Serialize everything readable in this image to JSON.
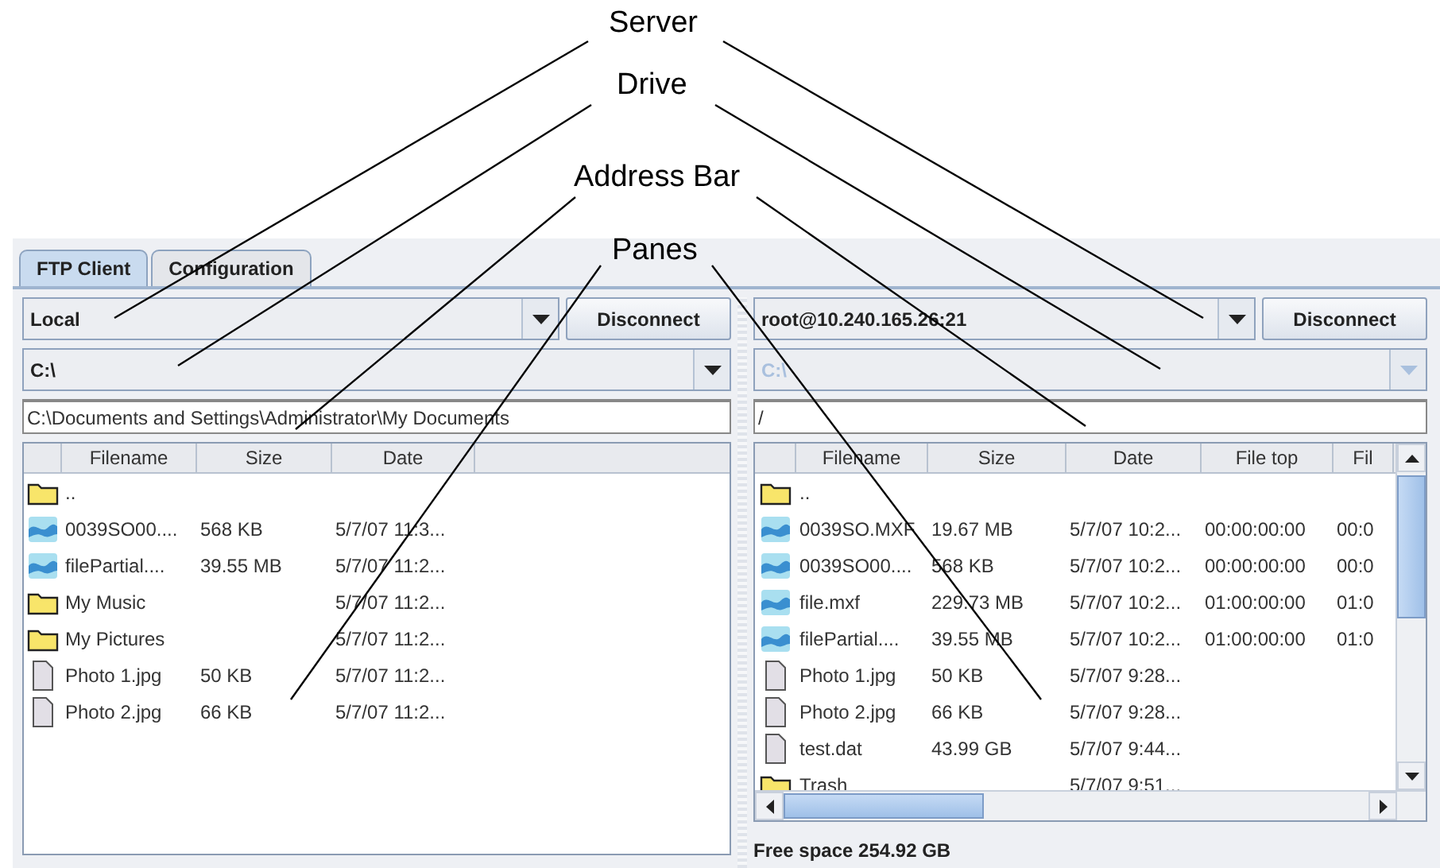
{
  "annotations": [
    {
      "label": "Server"
    },
    {
      "label": "Drive"
    },
    {
      "label": "Address Bar"
    },
    {
      "label": "Panes"
    }
  ],
  "tabs": [
    {
      "label": "FTP Client",
      "selected": true
    },
    {
      "label": "Configuration",
      "selected": false
    }
  ],
  "panes": [
    {
      "server": "Local",
      "connect_button": "Disconnect",
      "drive": {
        "value": "C:\\",
        "disabled": false
      },
      "address": "C:\\Documents and Settings\\Administrator\\My Documents",
      "scrollbars": false,
      "columns": [
        "Filename",
        "Size",
        "Date"
      ],
      "rows": [
        {
          "kind": "folder",
          "cells": [
            ".."
          ]
        },
        {
          "kind": "media",
          "cells": [
            "0039SO00....",
            "568 KB",
            "5/7/07 11:3..."
          ]
        },
        {
          "kind": "media",
          "cells": [
            "filePartial....",
            "39.55 MB",
            "5/7/07 11:2..."
          ]
        },
        {
          "kind": "folder",
          "cells": [
            "My Music",
            "",
            "5/7/07 11:2..."
          ]
        },
        {
          "kind": "folder",
          "cells": [
            "My Pictures",
            "",
            "5/7/07 11:2..."
          ]
        },
        {
          "kind": "file",
          "cells": [
            "Photo 1.jpg",
            "50 KB",
            "5/7/07 11:2..."
          ]
        },
        {
          "kind": "file",
          "cells": [
            "Photo 2.jpg",
            "66 KB",
            "5/7/07 11:2..."
          ]
        }
      ]
    },
    {
      "server": "root@10.240.165.26:21",
      "connect_button": "Disconnect",
      "drive": {
        "value": "C:\\",
        "disabled": true
      },
      "address": "/",
      "scrollbars": true,
      "columns": [
        "Filename",
        "Size",
        "Date",
        "File top",
        "Fil"
      ],
      "rows": [
        {
          "kind": "folder",
          "cells": [
            ".."
          ]
        },
        {
          "kind": "media",
          "cells": [
            "0039SO.MXF",
            "19.67 MB",
            "5/7/07 10:2...",
            "00:00:00:00",
            "00:0"
          ]
        },
        {
          "kind": "media",
          "cells": [
            "0039SO00....",
            "568 KB",
            "5/7/07 10:2...",
            "00:00:00:00",
            "00:0"
          ]
        },
        {
          "kind": "media",
          "cells": [
            "file.mxf",
            "229.73 MB",
            "5/7/07 10:2...",
            "01:00:00:00",
            "01:0"
          ]
        },
        {
          "kind": "media",
          "cells": [
            "filePartial....",
            "39.55 MB",
            "5/7/07 10:2...",
            "01:00:00:00",
            "01:0"
          ]
        },
        {
          "kind": "file",
          "cells": [
            "Photo 1.jpg",
            "50 KB",
            "5/7/07 9:28..."
          ]
        },
        {
          "kind": "file",
          "cells": [
            "Photo 2.jpg",
            "66 KB",
            "5/7/07 9:28..."
          ]
        },
        {
          "kind": "file",
          "cells": [
            "test.dat",
            "43.99 GB",
            "5/7/07 9:44..."
          ]
        },
        {
          "kind": "folder",
          "cells": [
            "Trash",
            "",
            "5/7/07 9:51..."
          ]
        }
      ],
      "free_space": "Free space 254.92 GB"
    }
  ]
}
